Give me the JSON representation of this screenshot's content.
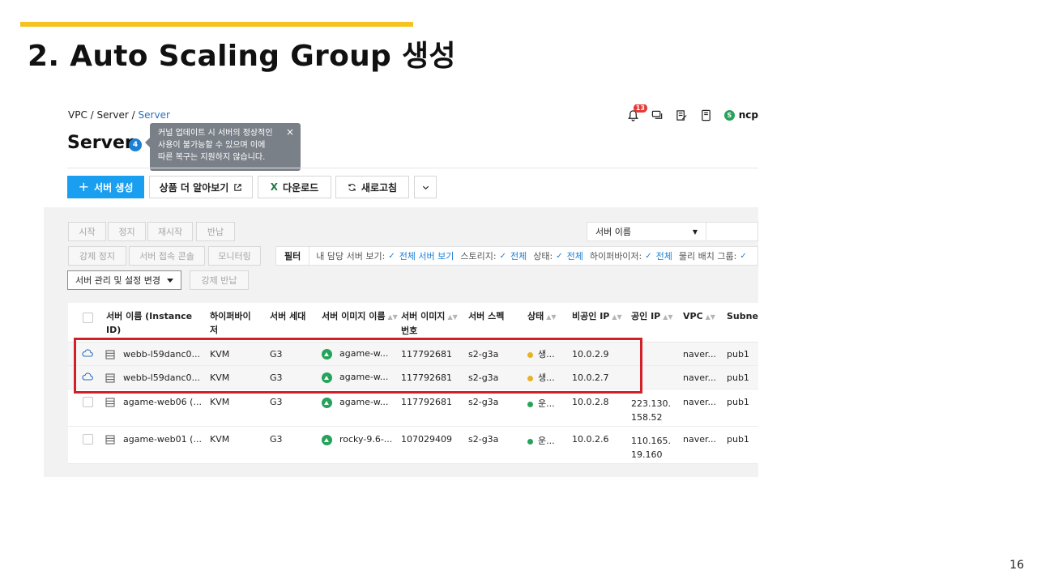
{
  "slide": {
    "title": "2. Auto Scaling Group 생성",
    "page_number": "16",
    "accent_color": "#f6c220"
  },
  "breadcrumb": {
    "root": "VPC",
    "sep1": " / ",
    "mid": "Server",
    "sep2": " / ",
    "current": "Server"
  },
  "topbar": {
    "notification_count": "13",
    "user_initial": "S",
    "user_name": "ncp"
  },
  "page": {
    "title": "Server",
    "count": "4"
  },
  "tooltip": {
    "line1": "커널 업데이트 시 서버의 정상적인",
    "line2": "사용이 불가능할 수 있으며 이에",
    "line3": "따른 복구는 지원하지 않습니다.",
    "close": "×"
  },
  "toolbar": {
    "create_label": "서버 생성",
    "learn_more_label": "상품 더 알아보기",
    "download_label": "다운로드",
    "refresh_label": "새로고침"
  },
  "actions": {
    "start": "시작",
    "stop": "정지",
    "restart": "재시작",
    "return": "반납",
    "force_stop": "강제 정지",
    "console": "서버 접속 콘솔",
    "monitoring": "모니터링",
    "manage": "서버 관리 및 설정 변경",
    "force_return": "강제 반납"
  },
  "search": {
    "select_label": "서버 이름"
  },
  "filter": {
    "label": "필터",
    "items": [
      {
        "key": "내 담당 서버 보기:",
        "value": "전체 서버 보기"
      },
      {
        "key": "스토리지:",
        "value": "전체"
      },
      {
        "key": "상태:",
        "value": "전체"
      },
      {
        "key": "하이퍼바이저:",
        "value": "전체"
      },
      {
        "key": "물리 배치 그룹:",
        "value": ""
      }
    ]
  },
  "table": {
    "headers": {
      "name": "서버 이름 (Instance",
      "name2": "ID)",
      "hypervisor": "하이퍼바이",
      "hypervisor2": "저",
      "generation": "서버 세대",
      "image_name": "서버 이미지 이름",
      "image_no": "서버 이미지",
      "image_no2": "번호",
      "spec": "서버 스펙",
      "status": "상태",
      "private_ip": "비공인 IP",
      "public_ip": "공인 IP",
      "vpc": "VPC",
      "subnet": "Subnet"
    },
    "rows": [
      {
        "name": "webb-l59danc0...",
        "hypervisor": "KVM",
        "generation": "G3",
        "image_name": "agame-w...",
        "image_no": "117792681",
        "spec": "s2-g3a",
        "status": "생...",
        "status_color": "#e6b325",
        "private_ip": "10.0.2.9",
        "public_ip1": "",
        "public_ip2": "",
        "vpc": "naver...",
        "subnet": "pub1",
        "icon": "cloud-icon"
      },
      {
        "name": "webb-l59danc0...",
        "hypervisor": "KVM",
        "generation": "G3",
        "image_name": "agame-w...",
        "image_no": "117792681",
        "spec": "s2-g3a",
        "status": "생...",
        "status_color": "#e6b325",
        "private_ip": "10.0.2.7",
        "public_ip1": "",
        "public_ip2": "",
        "vpc": "naver...",
        "subnet": "pub1",
        "icon": "cloud-icon"
      },
      {
        "name": "agame-web06 (...",
        "hypervisor": "KVM",
        "generation": "G3",
        "image_name": "agame-w...",
        "image_no": "117792681",
        "spec": "s2-g3a",
        "status": "운...",
        "status_color": "#26a35a",
        "private_ip": "10.0.2.8",
        "public_ip1": "223.130.",
        "public_ip2": "158.52",
        "vpc": "naver...",
        "subnet": "pub1",
        "icon": "checkbox"
      },
      {
        "name": "agame-web01 (...",
        "hypervisor": "KVM",
        "generation": "G3",
        "image_name": "rocky-9.6-...",
        "image_no": "107029409",
        "spec": "s2-g3a",
        "status": "운...",
        "status_color": "#26a35a",
        "private_ip": "10.0.2.6",
        "public_ip1": "110.165.",
        "public_ip2": "19.160",
        "vpc": "naver...",
        "subnet": "pub1",
        "icon": "checkbox"
      }
    ]
  },
  "highlight": {
    "color": "#d22027"
  }
}
